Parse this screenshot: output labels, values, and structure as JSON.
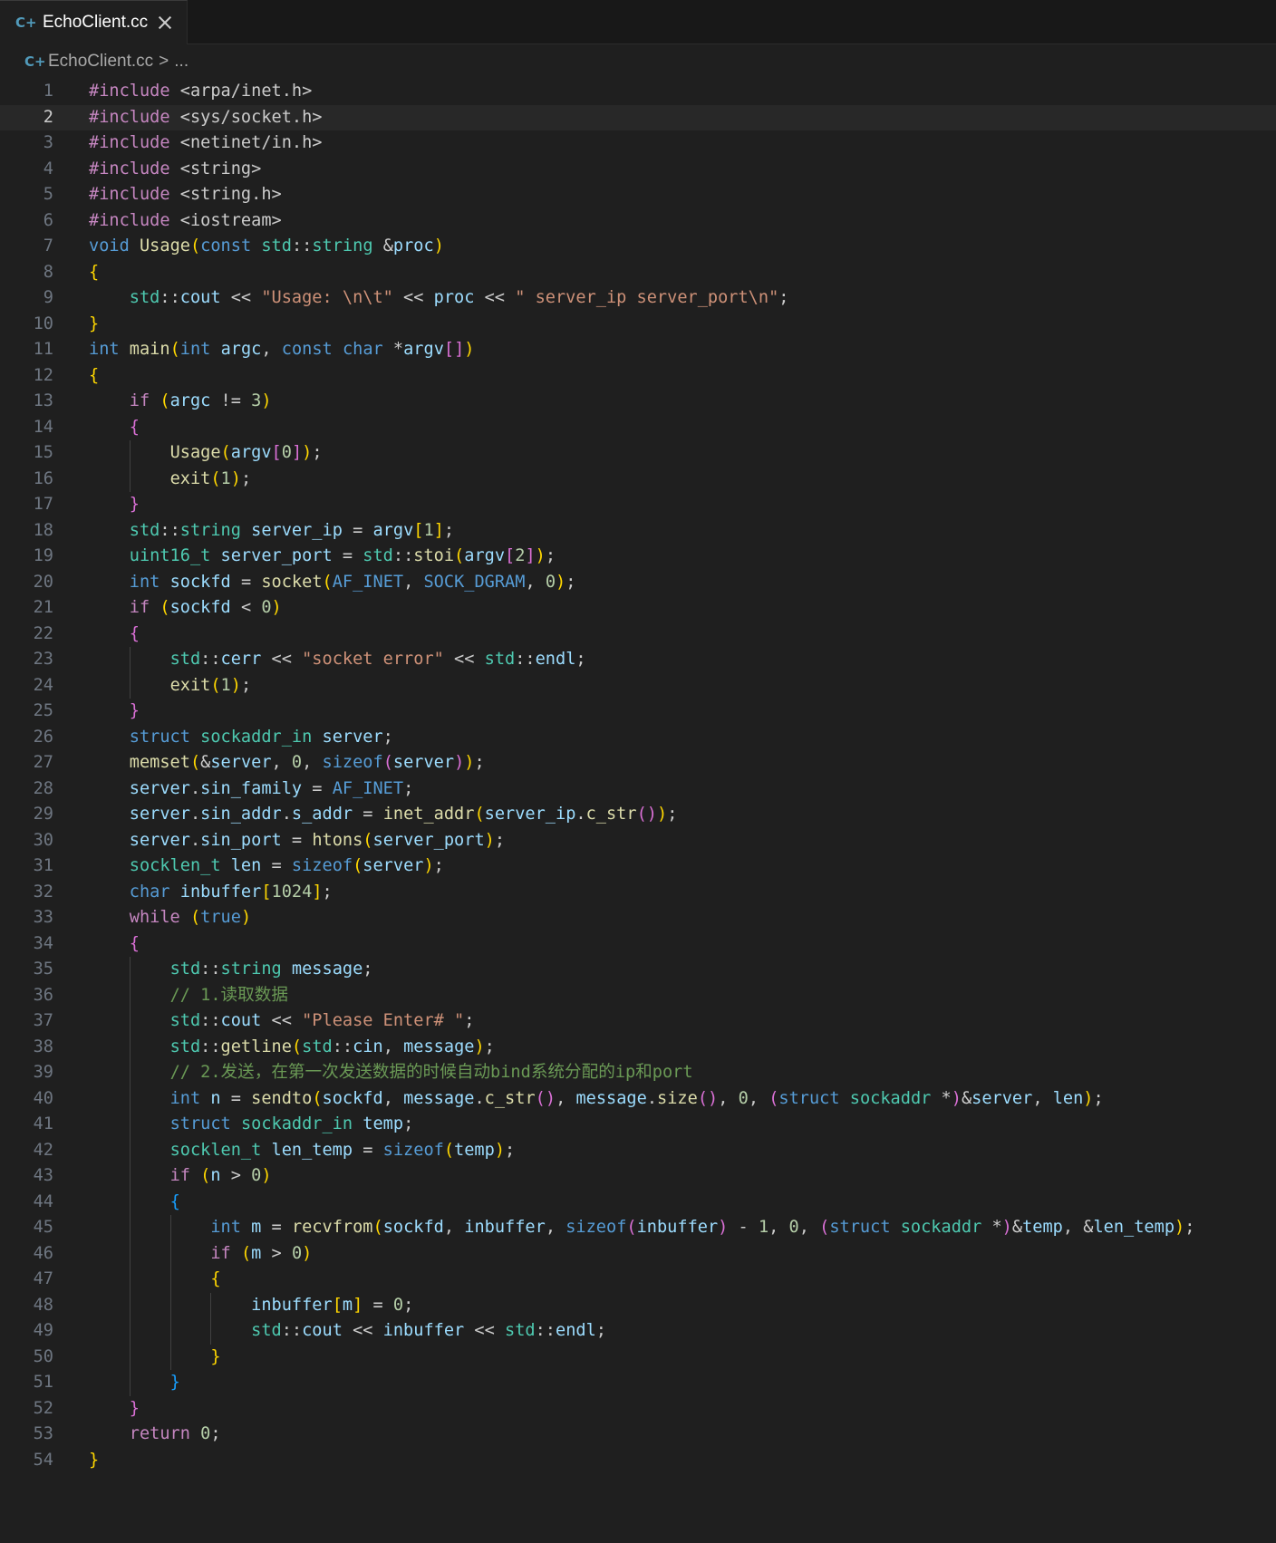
{
  "tab": {
    "label": "EchoClient.cc",
    "icon": "cpp-file-icon"
  },
  "breadcrumb": {
    "file": "EchoClient.cc",
    "separator": ">",
    "more": "..."
  },
  "editor": {
    "current_line": 2,
    "lines": [
      "#include <arpa/inet.h>",
      "#include <sys/socket.h>",
      "#include <netinet/in.h>",
      "#include <string>",
      "#include <string.h>",
      "#include <iostream>",
      "void Usage(const std::string &proc)",
      "{",
      "    std::cout << \"Usage: \\n\\t\" << proc << \" server_ip server_port\\n\";",
      "}",
      "int main(int argc, const char *argv[])",
      "{",
      "    if (argc != 3)",
      "    {",
      "        Usage(argv[0]);",
      "        exit(1);",
      "    }",
      "    std::string server_ip = argv[1];",
      "    uint16_t server_port = std::stoi(argv[2]);",
      "    int sockfd = socket(AF_INET, SOCK_DGRAM, 0);",
      "    if (sockfd < 0)",
      "    {",
      "        std::cerr << \"socket error\" << std::endl;",
      "        exit(1);",
      "    }",
      "    struct sockaddr_in server;",
      "    memset(&server, 0, sizeof(server));",
      "    server.sin_family = AF_INET;",
      "    server.sin_addr.s_addr = inet_addr(server_ip.c_str());",
      "    server.sin_port = htons(server_port);",
      "    socklen_t len = sizeof(server);",
      "    char inbuffer[1024];",
      "    while (true)",
      "    {",
      "        std::string message;",
      "        // 1.读取数据",
      "        std::cout << \"Please Enter# \";",
      "        std::getline(std::cin, message);",
      "        // 2.发送，在第一次发送数据的时候自动bind系统分配的ip和port",
      "        int n = sendto(sockfd, message.c_str(), message.size(), 0, (struct sockaddr *)&server, len);",
      "        struct sockaddr_in temp;",
      "        socklen_t len_temp = sizeof(temp);",
      "        if (n > 0)",
      "        {",
      "            int m = recvfrom(sockfd, inbuffer, sizeof(inbuffer) - 1, 0, (struct sockaddr *)&temp, &len_temp);",
      "            if (m > 0)",
      "            {",
      "                inbuffer[m] = 0;",
      "                std::cout << inbuffer << std::endl;",
      "            }",
      "        }",
      "    }",
      "    return 0;",
      "}"
    ]
  }
}
